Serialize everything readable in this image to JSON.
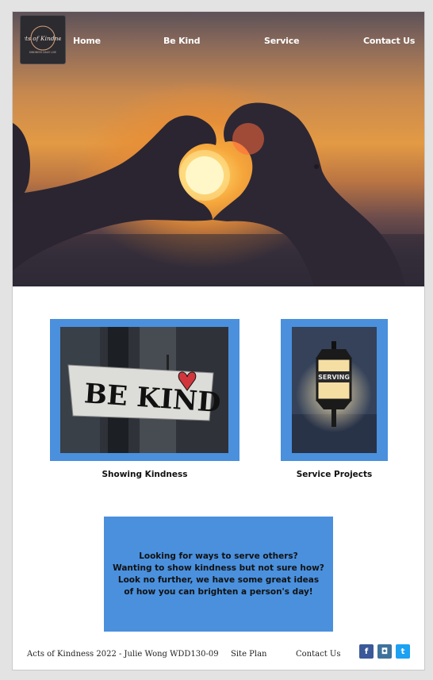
{
  "nav": {
    "logo_text": "Acts of Kindness",
    "logo_tagline": "KINDNESS DAILY LIVE",
    "items": [
      {
        "label": "Home"
      },
      {
        "label": "Be Kind"
      },
      {
        "label": "Service"
      },
      {
        "label": "Contact Us"
      }
    ]
  },
  "hero": {
    "image": "heart-hands-sunset-image"
  },
  "cards": [
    {
      "caption": "Showing Kindness",
      "sign_text": "BE KIND",
      "image": "be-kind-sign-image"
    },
    {
      "caption": "Service Projects",
      "sign_text": "SERVING",
      "image": "serving-lantern-image"
    }
  ],
  "callout": {
    "lines": [
      "Looking for ways to serve others?",
      "Wanting to show kindness but not sure how?",
      "Look no further, we have some great ideas",
      "of how you can brighten a person's day!"
    ]
  },
  "footer": {
    "copyright": "Acts of Kindness 2022 - Julie Wong WDD130-09",
    "site_plan": "Site Plan",
    "contact": "Contact Us",
    "social": [
      {
        "icon": "facebook-icon",
        "glyph": "f",
        "color": "#3b5998"
      },
      {
        "icon": "instagram-icon",
        "glyph": "◘",
        "color": "#3f729b"
      },
      {
        "icon": "twitter-icon",
        "glyph": "t",
        "color": "#1da1f2"
      }
    ]
  },
  "colors": {
    "accent": "#4a90dd",
    "page": "#ffffff",
    "backdrop": "#e3e3e3"
  }
}
